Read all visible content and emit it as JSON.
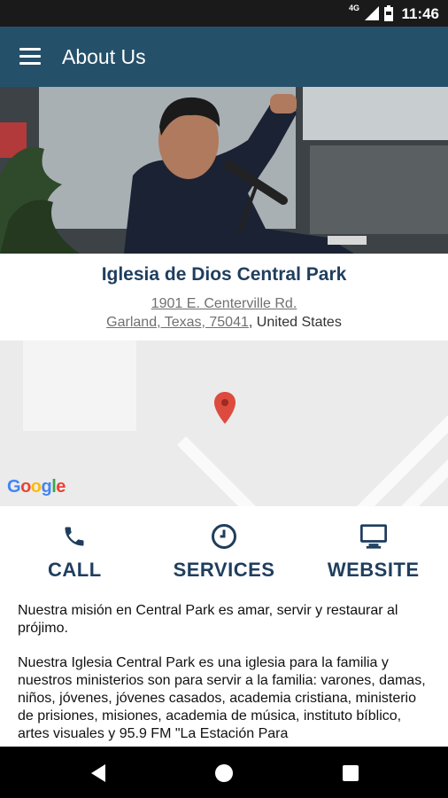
{
  "status_bar": {
    "network": "4G",
    "time": "11:46"
  },
  "app_bar": {
    "title": "About Us"
  },
  "church": {
    "name": "Iglesia de Dios Central Park",
    "address_line1": "1901 E. Centerville Rd.",
    "address_city": "Garland, Texas, 75041",
    "address_country": ", United States"
  },
  "map": {
    "attribution": "Google"
  },
  "actions": [
    {
      "label": "CALL",
      "icon": "phone-icon"
    },
    {
      "label": "SERVICES",
      "icon": "clock-icon"
    },
    {
      "label": "WEBSITE",
      "icon": "monitor-icon"
    }
  ],
  "description": {
    "paragraph1": "Nuestra misión en Central Park es amar, servir y restaurar al prójimo.",
    "paragraph2": "Nuestra Iglesia Central Park es una iglesia para la familia y nuestros ministerios son para servir a la familia: varones, damas, niños, jóvenes, jóvenes casados, academia cristiana, ministerio de prisiones, misiones, academia de música, instituto bíblico, artes visuales y 95.9 FM \"La Estación Para"
  },
  "colors": {
    "app_bar": "#25506a",
    "accent_text": "#1f3e5e"
  }
}
